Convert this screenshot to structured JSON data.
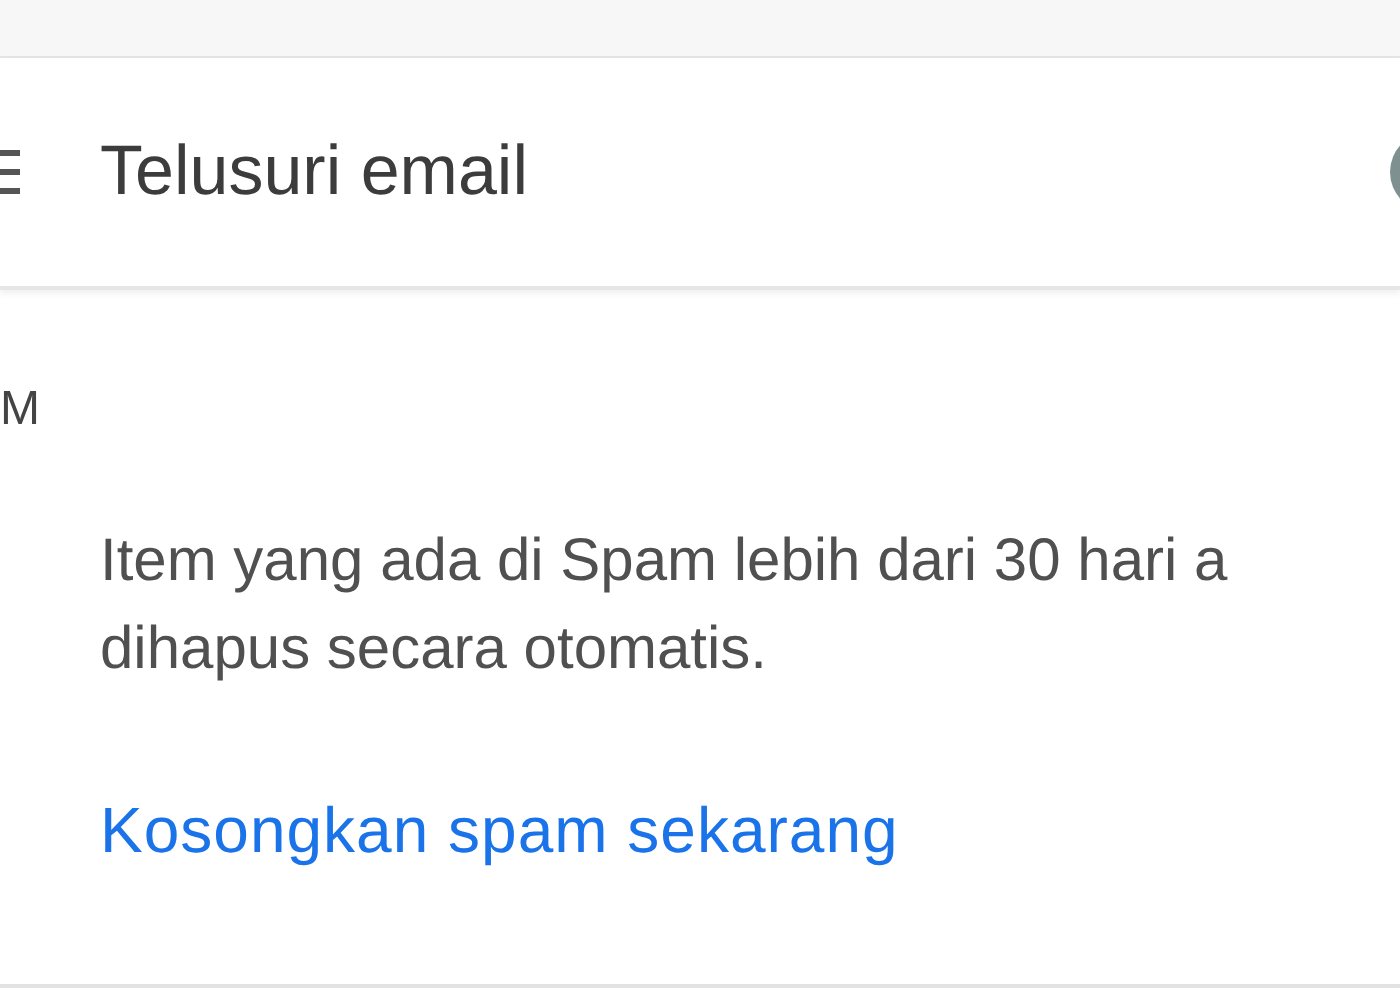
{
  "search": {
    "placeholder": "Telusuri email"
  },
  "folder_label": "M",
  "notice": {
    "lines": [
      "Item yang ada di Spam lebih dari 30 hari a",
      "dihapus secara otomatis."
    ]
  },
  "action_link": "Kosongkan spam sekarang"
}
